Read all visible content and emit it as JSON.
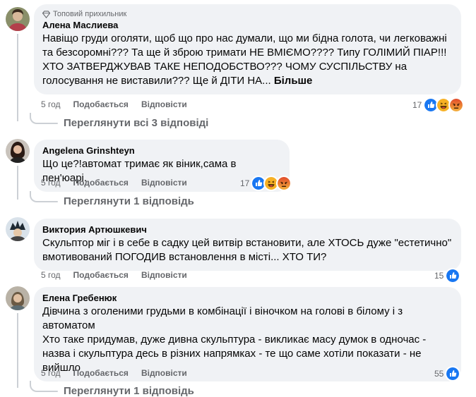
{
  "comments": [
    {
      "badge": "Топовий прихильник",
      "author": "Алена Маслиева",
      "text": "Навіщо груди оголяти, щоб що про нас думали, що ми бідна голота, чи легковажні та безсоромні??? Та ще й зброю тримати НЕ ВМІЄМО???? Типу ГОЛІМИЙ ПІАР!!! ХТО ЗАТВЕРДЖУВАВ ТАКЕ НЕПОДОБСТВО??? ЧОМУ СУСПІЛЬСТВУ на голосування не виставили??? Ще й ДІТИ НА... ",
      "more": "Більше",
      "time": "5 год",
      "like": "Подобається",
      "reply": "Відповісти",
      "reaction_count": "17",
      "replies_link": "Переглянути всі 3 відповіді"
    },
    {
      "author": "Angelena Grinshteyn",
      "text": "Що це?!автомат тримає як віник,сама в пен'юарі.",
      "time": "5 год",
      "like": "Подобається",
      "reply": "Відповісти",
      "reaction_count": "17",
      "replies_link": "Переглянути 1 відповідь"
    },
    {
      "author": "Виктория Артюшкевич",
      "text": "Скульптор міг і в себе в садку цей витвір встановити, але ХТОСЬ дуже \"естетично\" вмотивований ПОГОДИВ встановлення в місті... ХТО ТИ?",
      "time": "5 год",
      "like": "Подобається",
      "reply": "Відповісти",
      "reaction_count": "15"
    },
    {
      "author": "Елена Гребенюк",
      "text": "Дівчина з оголеними грудьми в комбінації і віночком на голові в білому і з автоматом\nХто таке придумав, дуже дивна скульптура - викликає масу думок в одночас - назва і скульптура десь в різних напрямках - те що саме хотіли показати - не вийшло",
      "time": "5 год",
      "like": "Подобається",
      "reply": "Відповісти",
      "reaction_count": "55",
      "replies_link": "Переглянути 1 відповідь"
    }
  ],
  "icons": {
    "like": "like-icon",
    "haha": "haha-icon",
    "angry": "angry-icon",
    "badge": "diamond-badge-icon"
  },
  "colors": {
    "like": "#1877f2",
    "haha": "#f7b125",
    "angry": "#e9710f",
    "bubble": "#f0f2f5"
  }
}
